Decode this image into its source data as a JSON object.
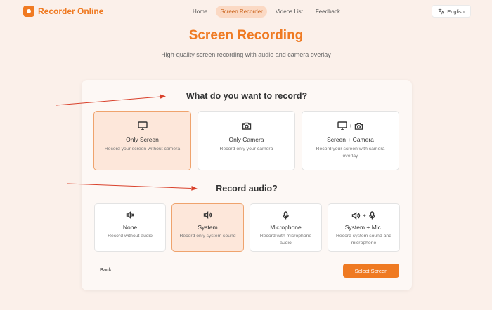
{
  "header": {
    "brand": "Recorder Online",
    "nav": [
      {
        "label": "Home",
        "active": false
      },
      {
        "label": "Screen Recorder",
        "active": true
      },
      {
        "label": "Videos List",
        "active": false
      },
      {
        "label": "Feedback",
        "active": false
      }
    ],
    "language": "English"
  },
  "hero": {
    "title": "Screen Recording",
    "subtitle": "High-quality screen recording with audio and camera overlay"
  },
  "record_section": {
    "title": "What do you want to record?",
    "options": [
      {
        "label": "Only Screen",
        "desc": "Record your screen without camera",
        "icon": "monitor-icon",
        "selected": true
      },
      {
        "label": "Only Camera",
        "desc": "Record only your camera",
        "icon": "camera-icon",
        "selected": false
      },
      {
        "label": "Screen + Camera",
        "desc": "Record your screen with camera overlay",
        "icon": "monitor-camera-icon",
        "selected": false
      }
    ]
  },
  "audio_section": {
    "title": "Record audio?",
    "options": [
      {
        "label": "None",
        "desc": "Record without audio",
        "icon": "speaker-muted-icon",
        "selected": false
      },
      {
        "label": "System",
        "desc": "Record only system sound",
        "icon": "speaker-icon",
        "selected": true
      },
      {
        "label": "Microphone",
        "desc": "Record with microphone audio",
        "icon": "microphone-icon",
        "selected": false
      },
      {
        "label": "System + Mic.",
        "desc": "Record system sound and microphone",
        "icon": "speaker-mic-icon",
        "selected": false
      }
    ]
  },
  "footer": {
    "back_label": "Back",
    "primary_label": "Select Screen"
  },
  "colors": {
    "accent": "#ef7a22",
    "selected_bg": "#fde7da",
    "page_bg": "#fbf0ea",
    "annotation_arrow": "#d9412b"
  }
}
